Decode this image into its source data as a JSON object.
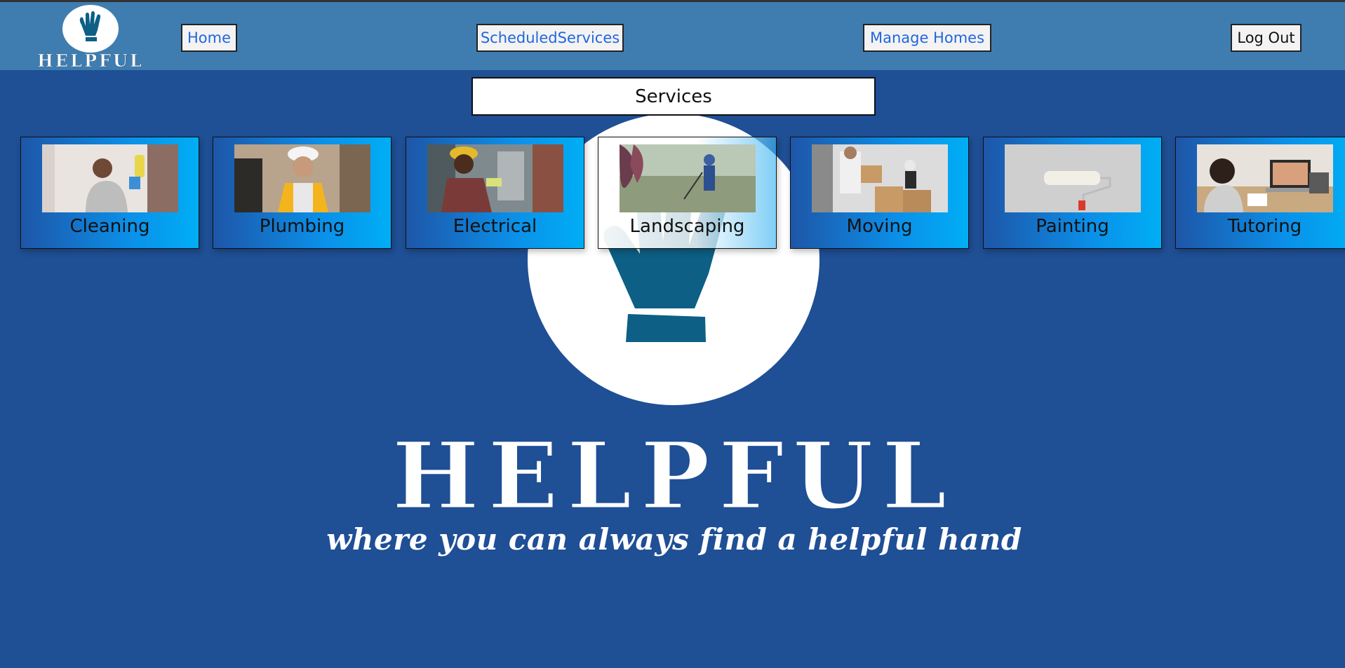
{
  "brand": {
    "name": "HELPFUL",
    "tagline": "where you can always find a helpful hand"
  },
  "nav": {
    "home": "Home",
    "scheduled": "ScheduledServices",
    "manage_homes": "Manage Homes",
    "logout": "Log Out"
  },
  "services": {
    "title": "Services",
    "items": [
      {
        "label": "Cleaning"
      },
      {
        "label": "Plumbing"
      },
      {
        "label": "Electrical"
      },
      {
        "label": "Landscaping"
      },
      {
        "label": "Moving"
      },
      {
        "label": "Painting"
      },
      {
        "label": "Tutoring"
      }
    ]
  },
  "colors": {
    "page_bg": "#1f4f95",
    "topbar_bg": "#3f7db0",
    "glove": "#0d5f85",
    "link_text": "#2266dd"
  }
}
